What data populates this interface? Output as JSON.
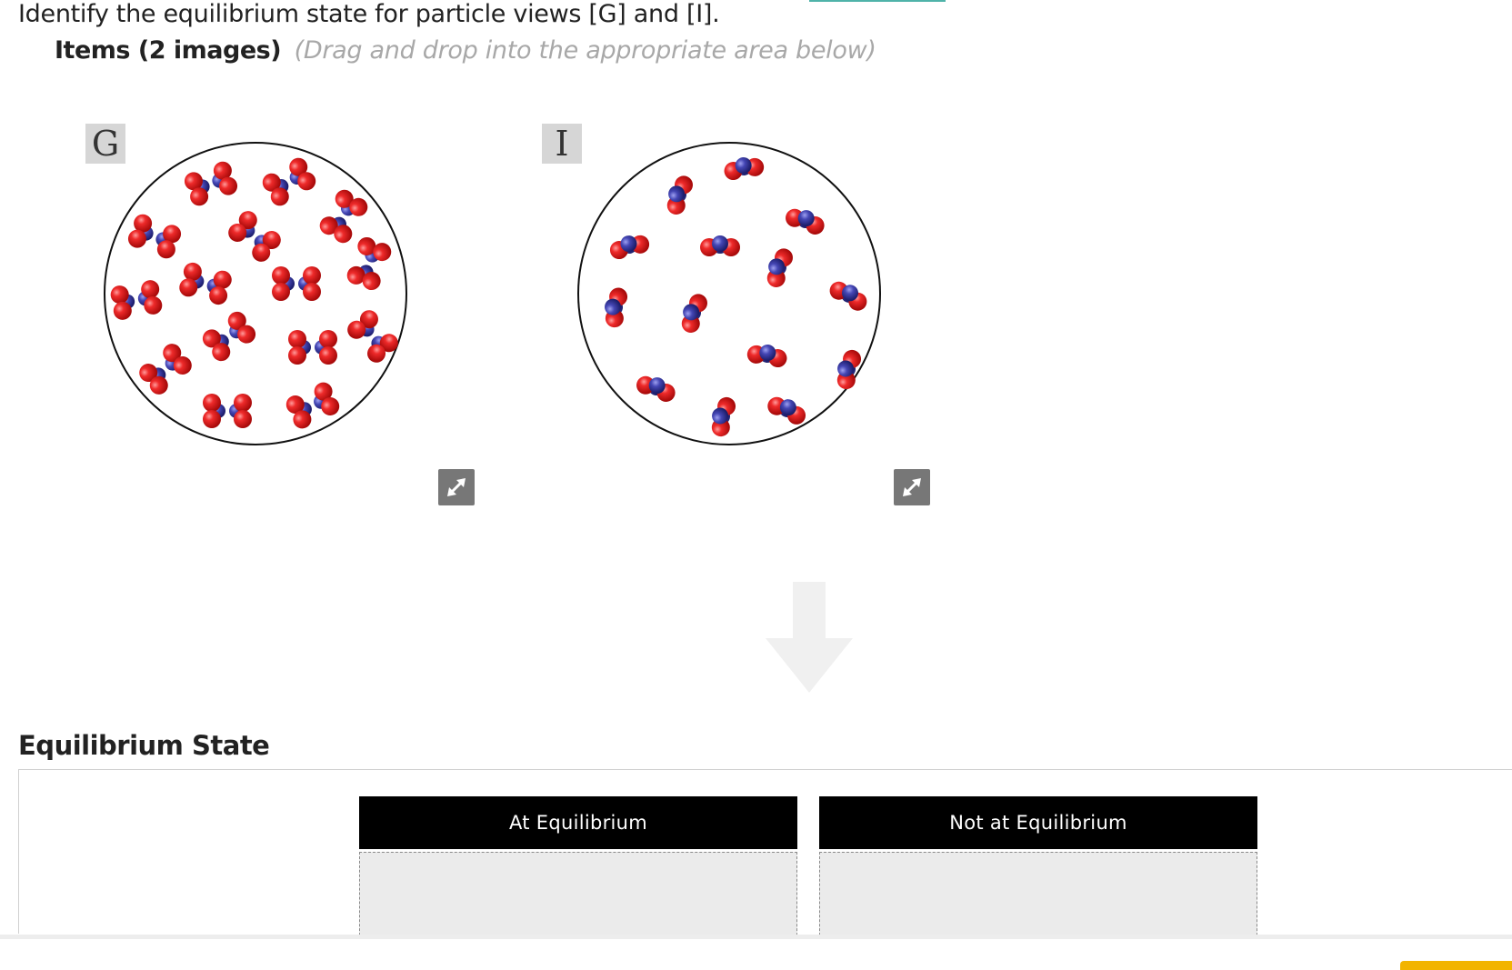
{
  "question": "Identify the equilibrium state for particle views [G] and [I].",
  "items": {
    "heading": "Items (2 images)",
    "hint": "(Drag and drop into the appropriate area below)",
    "cards": [
      {
        "label": "G",
        "expand_icon": "expand-arrows-icon"
      },
      {
        "label": "I",
        "expand_icon": "expand-arrows-icon"
      }
    ]
  },
  "section": {
    "title": "Equilibrium State",
    "categories": [
      {
        "label": "At Equilibrium"
      },
      {
        "label": "Not at Equilibrium"
      }
    ]
  },
  "colors": {
    "oxygen": "#e0161c",
    "nitrogen": "#3d3fa8",
    "header": "#000000",
    "drop_zone": "#ebebeb"
  }
}
